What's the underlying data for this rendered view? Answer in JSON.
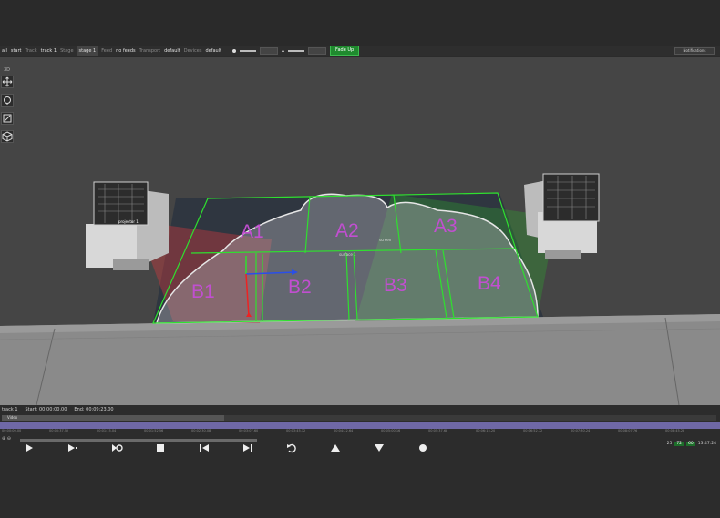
{
  "toolbar": {
    "app": "all",
    "start_label": "start",
    "track_key": "Track",
    "track_val": "track 1",
    "stage_key": "Stage",
    "stage_val": "stage 1",
    "feed_key": "Feed",
    "feed_val": "no feeds",
    "transport_key": "Transport",
    "transport_val": "default",
    "devices_key": "Devices",
    "devices_val": "default",
    "fade_label": "Fade Up"
  },
  "notifications_label": "Notifications",
  "view_label": "3D",
  "scene": {
    "projector_left_label": "projector 1",
    "screen_label": "screen",
    "surface_label": "surface 1",
    "regions": [
      "A1",
      "A2",
      "A3",
      "B1",
      "B2",
      "B3",
      "B4"
    ],
    "region_color": "#c14fd0",
    "outline_color": "#2fe02f"
  },
  "timeline": {
    "track_name": "track 1",
    "start": "Start: 00:00:00.00",
    "end": "End: 00:09:23.00",
    "layer_label": "Video",
    "times": [
      "00:00:00.00",
      "00:00:37.52",
      "00:01:15.04",
      "00:01:52.56",
      "00:02:30.08",
      "00:03:07.60",
      "00:03:45.12",
      "00:04:22.64",
      "00:05:00.16",
      "00:05:37.68",
      "00:06:15.20",
      "00:06:52.72",
      "00:07:30.24",
      "00:08:07.76",
      "00:08:45.28"
    ],
    "status_a": "25",
    "status_b": "72",
    "status_c": "60",
    "clock": "13:47:24"
  }
}
